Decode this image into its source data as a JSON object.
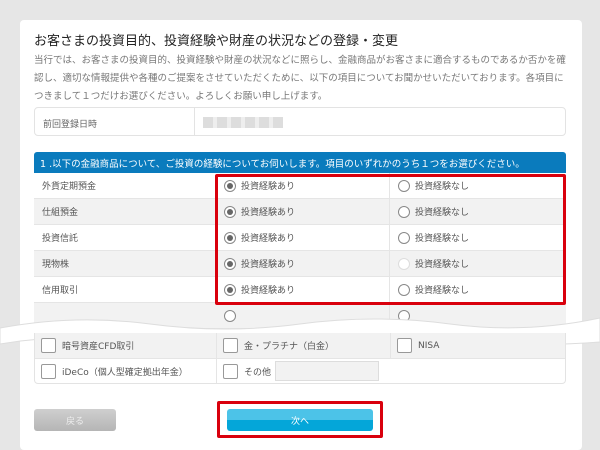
{
  "title": "お客さまの投資目的、投資経験や財産の状況などの登録・変更",
  "description": "当行では、お客さまの投資目的、投資経験や財産の状況などに照らし、金融商品がお客さまに適合するものであるか否かを確認し、適切な情報提供や各種のご提案をさせていただくために、以下の項目についてお聞かせいただいております。各項目につきまして１つだけお選びください。よろしくお願い申し上げます。",
  "last_registered": {
    "label": "前回登録日時"
  },
  "question1": {
    "heading": "1 .以下の金融商品について、ご投資の経験についてお伺いします。項目のいずれかのうち１つをお選びください。",
    "rows": [
      {
        "label": "外貨定期預金",
        "yes": "投資経験あり",
        "no": "投資経験なし",
        "selected": "yes"
      },
      {
        "label": "仕組預金",
        "yes": "投資経験あり",
        "no": "投資経験なし",
        "selected": "yes"
      },
      {
        "label": "投資信託",
        "yes": "投資経験あり",
        "no": "投資経験なし",
        "selected": "yes"
      },
      {
        "label": "現物株",
        "yes": "投資経験あり",
        "no": "投資経験なし",
        "selected": "yes"
      },
      {
        "label": "信用取引",
        "yes": "投資経験あり",
        "no": "投資経験なし",
        "selected": "yes"
      }
    ]
  },
  "checkboxes": [
    [
      "暗号資産CFD取引",
      "金・プラチナ（白金）",
      "NISA"
    ],
    [
      "iDeCo（個人型確定拠出年金）",
      "その他"
    ]
  ],
  "buttons": {
    "back": "戻る",
    "next": "次へ"
  },
  "colors": {
    "header": "#0a7bbd",
    "highlight": "#d9000d",
    "next": "#04a6d9"
  }
}
